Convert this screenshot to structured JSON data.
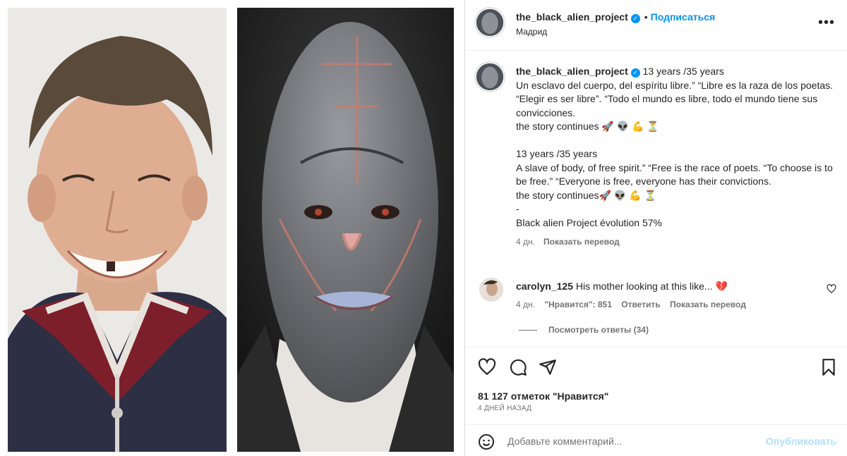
{
  "post": {
    "username": "the_black_alien_project",
    "follow_label": "Подписаться",
    "location": "Мадрид",
    "more_glyph": "•••"
  },
  "caption": {
    "username": "the_black_alien_project",
    "lines": [
      "13 years /35 years",
      "Un esclavo del cuerpo, del espíritu libre.” “Libre es la raza de los poetas. “Elegir es ser libre”. “Todo el mundo es libre, todo el mundo tiene sus convicciones.",
      "the story continues 🚀 👽 💪 ⏳",
      "",
      "13 years /35 years",
      "A slave of body, of free spirit.” “Free is the race of poets. “To choose is to be free.” “Everyone is free, everyone has their convictions.",
      "the story continues🚀 👽 💪 ⏳",
      "-",
      "Black alien Project évolution 57%"
    ],
    "time": "4 дн.",
    "translate_label": "Показать перевод"
  },
  "comment": {
    "username": "carolyn_125",
    "text": "His mother looking at this like... 💔",
    "time": "4 дн.",
    "likes": "\"Нравится\": 851",
    "reply_label": "Ответить",
    "translate_label": "Показать перевод",
    "view_replies": "Посмотреть ответы (34)"
  },
  "actions": {
    "likes_count": "81 127 отметок \"Нравится\"",
    "date": "4 ДНЕЙ НАЗАД",
    "comment_placeholder": "Добавьте комментарий...",
    "publish_label": "Опубликовать",
    "icons": [
      "heart-icon",
      "comment-icon",
      "share-icon",
      "bookmark-icon",
      "emoji-icon"
    ]
  },
  "colors": {
    "accent": "#0095f6",
    "publish_disabled": "#b2dffc",
    "secondary_text": "#737373"
  }
}
